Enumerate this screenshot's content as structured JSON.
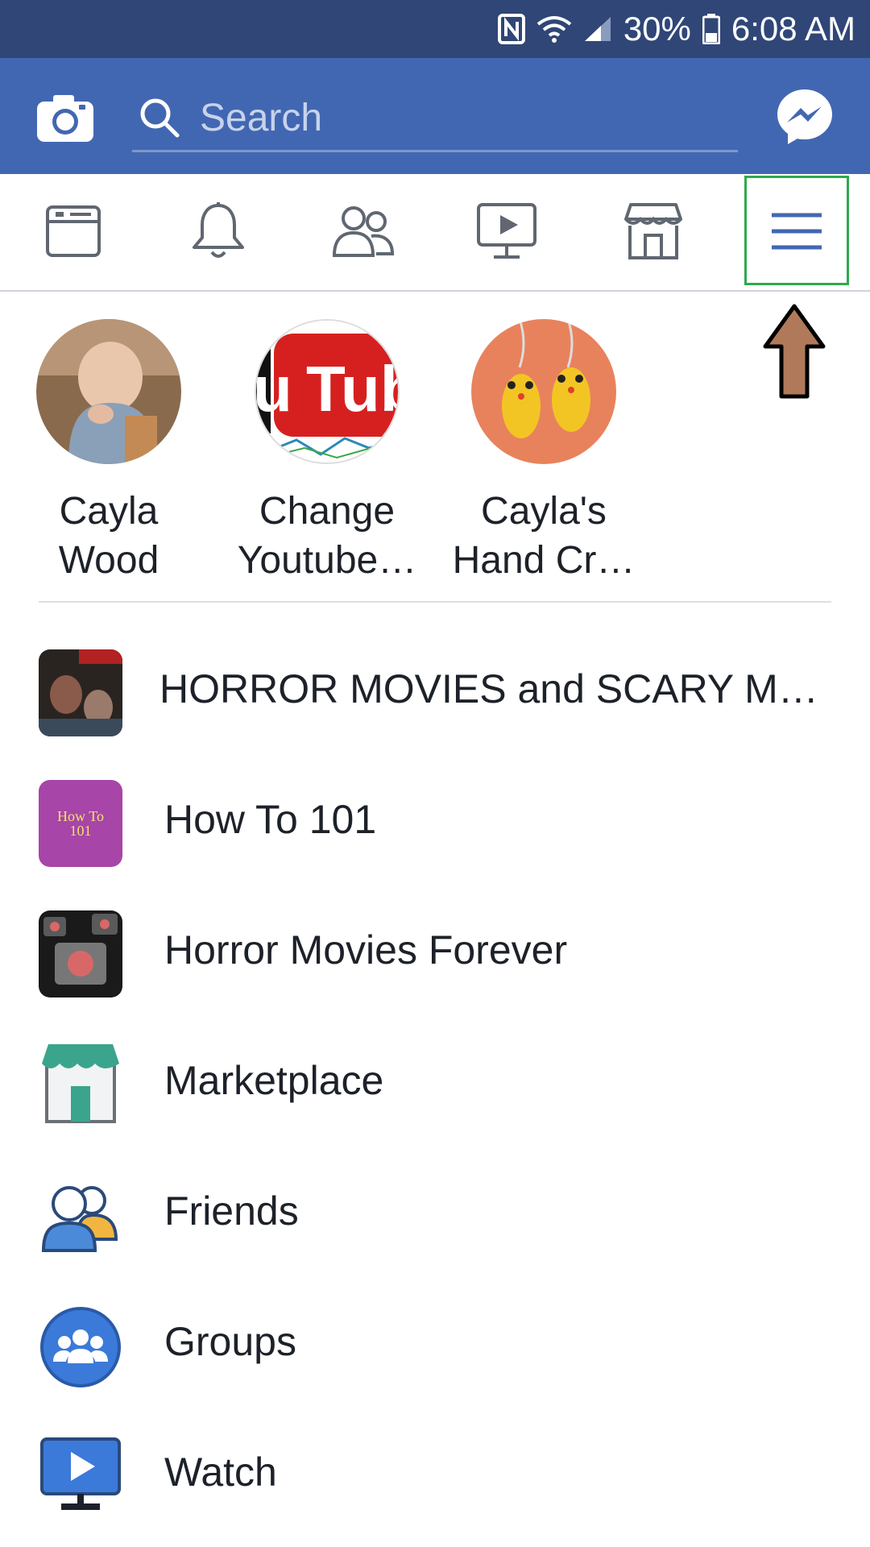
{
  "status_bar": {
    "battery": "30%",
    "time": "6:08 AM"
  },
  "header": {
    "search_placeholder": "Search"
  },
  "nav_tabs": [
    "news-feed",
    "notifications",
    "friend-requests",
    "watch",
    "marketplace",
    "menu"
  ],
  "shortcuts": [
    {
      "label": "Cayla\nWood"
    },
    {
      "label": "Change\nYoutube…"
    },
    {
      "label": "Cayla's\nHand Cr…"
    }
  ],
  "menu_list": [
    {
      "label": "HORROR MOVIES and SCARY MO…"
    },
    {
      "label": "How To 101",
      "thumb_text": "How To\n101"
    },
    {
      "label": "Horror Movies Forever"
    },
    {
      "label": "Marketplace"
    },
    {
      "label": "Friends"
    },
    {
      "label": "Groups"
    },
    {
      "label": "Watch"
    }
  ],
  "colors": {
    "status_bar": "#2f4677",
    "header": "#4267b2",
    "highlight_box": "#2eaa4e",
    "arrow": "#b07a5a"
  }
}
